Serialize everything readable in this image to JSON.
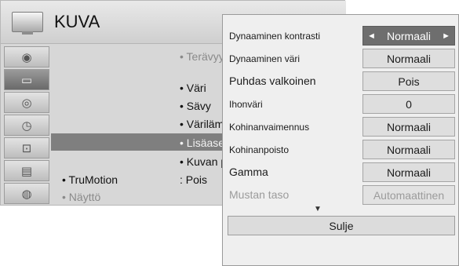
{
  "menu": {
    "title": "KUVA",
    "items": [
      {
        "label": "• Terävyys",
        "dim": true
      },
      {
        "label": "• Väri"
      },
      {
        "label": "• Sävy"
      },
      {
        "label": "• Värilämpötila"
      },
      {
        "label": "• Lisäasetukset",
        "highlight": true
      },
      {
        "label": "• Kuvan palautus"
      }
    ],
    "trumotion": {
      "label": "• TruMotion",
      "value": ": Pois"
    },
    "display": {
      "label": "• Näyttö"
    },
    "side_icons": [
      "picture-icon",
      "audio-icon",
      "time-icon",
      "lock-icon",
      "input-icon",
      "network-icon"
    ]
  },
  "popup": {
    "rows": [
      {
        "label": "Dynaaminen kontrasti",
        "value": "Normaali",
        "size": "small",
        "selected": true
      },
      {
        "label": "Dynaaminen väri",
        "value": "Normaali",
        "size": "small"
      },
      {
        "label": "Puhdas valkoinen",
        "value": "Pois",
        "size": "medium"
      },
      {
        "label": "Ihonväri",
        "value": "0",
        "size": "small"
      },
      {
        "label": "Kohinanvaimennus",
        "value": "Normaali",
        "size": "small"
      },
      {
        "label": "Kohinanpoisto",
        "value": "Normaali",
        "size": "small"
      },
      {
        "label": "Gamma",
        "value": "Normaali",
        "size": "medium"
      },
      {
        "label": "Mustan taso",
        "value": "Automaattinen",
        "size": "medium",
        "disabled": true
      }
    ],
    "close_label": "Sulje",
    "more_arrow": "▼",
    "left_arrow": "◄",
    "right_arrow": "►"
  }
}
